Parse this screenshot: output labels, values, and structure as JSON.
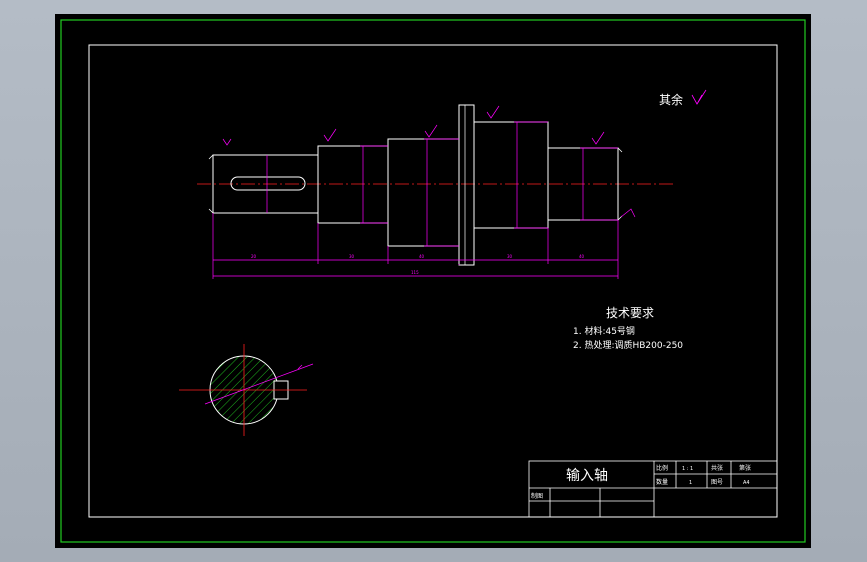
{
  "drawing": {
    "surface_finish_note": "其余",
    "tech_requirements": {
      "title": "技术要求",
      "items": [
        "1. 材料:45号钢",
        "2. 热处理:调质HB200-250"
      ]
    },
    "title_block": {
      "part_name": "输入轴",
      "scale_label": "比例",
      "scale_value": "1 : 1",
      "quantity_label": "数量",
      "quantity_value": "1",
      "sheet_label": "共张",
      "sheet_label2": "第张",
      "material_label": "图号",
      "material_value": "A4",
      "drawn_by_label": "制图"
    },
    "colors": {
      "border_outer": "#22cc22",
      "frame": "#ffffff",
      "part_outline": "#ffffff",
      "dimension": "#ff00ff",
      "centerline": "#ff2020",
      "hatch": "#22cc22",
      "text": "#ffffff"
    }
  }
}
